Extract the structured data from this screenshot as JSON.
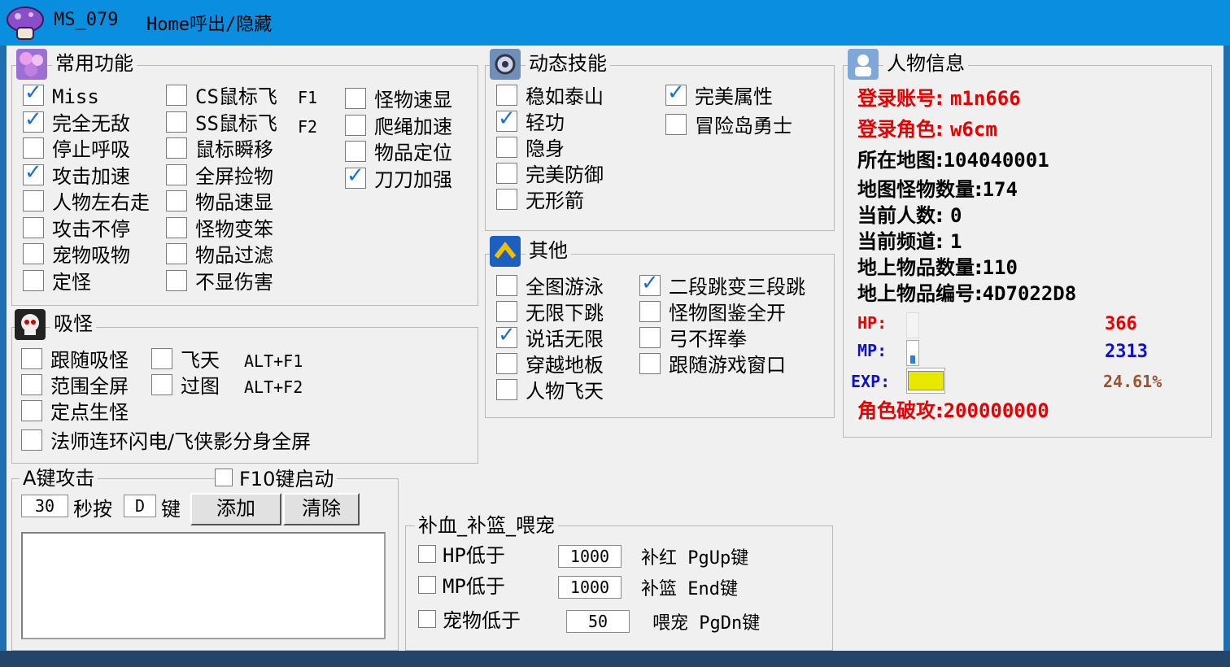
{
  "window": {
    "app_name": "MS_079",
    "hint": "Home呼出/隐藏"
  },
  "common": {
    "title": "常用功能",
    "col1": [
      {
        "label": "Miss",
        "checked": true
      },
      {
        "label": "完全无敌",
        "checked": true
      },
      {
        "label": "停止呼吸",
        "checked": false
      },
      {
        "label": "攻击加速",
        "checked": true
      },
      {
        "label": "人物左右走",
        "checked": false
      },
      {
        "label": "攻击不停",
        "checked": false
      },
      {
        "label": "宠物吸物",
        "checked": false
      },
      {
        "label": "定怪",
        "checked": false
      }
    ],
    "col2": [
      {
        "label": "CS鼠标飞",
        "checked": false
      },
      {
        "label": "SS鼠标飞",
        "checked": false
      },
      {
        "label": "鼠标瞬移",
        "checked": false
      },
      {
        "label": "全屏捡物",
        "checked": false
      },
      {
        "label": "物品速显",
        "checked": false
      },
      {
        "label": "怪物变笨",
        "checked": false
      },
      {
        "label": "物品过滤",
        "checked": false
      },
      {
        "label": "不显伤害",
        "checked": false
      }
    ],
    "hotkey1": "F1",
    "hotkey2": "F2",
    "col3": [
      {
        "label": "怪物速显",
        "checked": false
      },
      {
        "label": "爬绳加速",
        "checked": false
      },
      {
        "label": "物品定位",
        "checked": false
      },
      {
        "label": "刀刀加强",
        "checked": true
      }
    ]
  },
  "dynamic": {
    "title": "动态技能",
    "col1": [
      {
        "label": "稳如泰山",
        "checked": false
      },
      {
        "label": "轻功",
        "checked": true
      },
      {
        "label": "隐身",
        "checked": false
      },
      {
        "label": "完美防御",
        "checked": false
      },
      {
        "label": "无形箭",
        "checked": false
      }
    ],
    "col2": [
      {
        "label": "完美属性",
        "checked": true
      },
      {
        "label": "冒险岛勇士",
        "checked": false
      }
    ]
  },
  "other": {
    "title": "其他",
    "col1": [
      {
        "label": "全图游泳",
        "checked": false
      },
      {
        "label": "无限下跳",
        "checked": false
      },
      {
        "label": "说话无限",
        "checked": true
      },
      {
        "label": "穿越地板",
        "checked": false
      },
      {
        "label": "人物飞天",
        "checked": false
      }
    ],
    "col2": [
      {
        "label": "二段跳变三段跳",
        "checked": true
      },
      {
        "label": "怪物图鉴全开",
        "checked": false
      },
      {
        "label": "弓不挥拳",
        "checked": false
      },
      {
        "label": "跟随游戏窗口",
        "checked": false
      }
    ]
  },
  "absorb": {
    "title": "吸怪",
    "items": [
      {
        "label": "跟随吸怪",
        "checked": false
      },
      {
        "label": "范围全屏",
        "checked": false
      },
      {
        "label": "定点生怪",
        "checked": false
      },
      {
        "label": "法师连环闪电/飞侠影分身全屏",
        "checked": false
      }
    ],
    "fly": {
      "label": "飞天",
      "checked": false,
      "hotkey": "ALT+F1"
    },
    "passmap": {
      "label": "过图",
      "checked": false,
      "hotkey": "ALT+F2"
    }
  },
  "character": {
    "title": "人物信息",
    "account_label": "登录账号:",
    "account_value": "m1n666",
    "role_label": "登录角色:",
    "role_value": "w6cm",
    "map_label": "所在地图:",
    "map_value": "104040001",
    "monsters_label": "地图怪物数量:",
    "monsters_value": "174",
    "people_label": "当前人数:",
    "people_value": "0",
    "channel_label": "当前频道:",
    "channel_value": "1",
    "items_label": "地上物品数量:",
    "items_value": "110",
    "item_id_label": "地上物品编号:",
    "item_id_value": "4D7022D8",
    "hp_label": "HP:",
    "hp_value": "366",
    "hp_fill": 0.0,
    "mp_label": "MP:",
    "mp_value": "2313",
    "mp_fill": 0.35,
    "exp_label": "EXP:",
    "exp_value": "24.61%",
    "exp_fill": 0.95,
    "damage_label": "角色破攻:",
    "damage_value": "200000000",
    "colors": {
      "red": "#e60000",
      "blue": "#1010c8",
      "brown": "#a0522d",
      "exp_bar": "#e8e800"
    }
  },
  "akey": {
    "title": "A键攻击",
    "f10_label": "F10键启动",
    "f10_checked": false,
    "seconds_value": "30",
    "seconds_label": "秒按",
    "key_value": "D",
    "key_label": "键",
    "add_label": "添加",
    "clear_label": "清除"
  },
  "recover": {
    "title": "补血_补篮_喂宠",
    "rows": [
      {
        "label": "HP低于",
        "value": "1000",
        "action": "补红 PgUp键",
        "checked": false
      },
      {
        "label": "MP低于",
        "value": "1000",
        "action": "补篮 End键",
        "checked": false
      },
      {
        "label": "宠物低于",
        "value": "50",
        "action": "喂宠 PgDn键",
        "checked": false
      }
    ]
  }
}
